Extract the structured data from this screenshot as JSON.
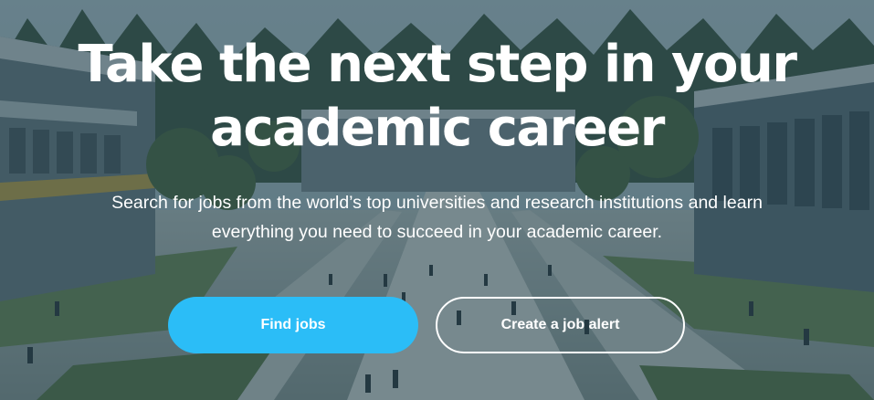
{
  "hero": {
    "title_line1": "Take the next step in your",
    "title_line2": "academic career",
    "subtitle_line1": "Search for jobs from the world’s top universities and research institutions and learn",
    "subtitle_line2": "everything you need to succeed in your academic career.",
    "background": "campus-plaza-photo"
  },
  "actions": {
    "find_jobs_label": "Find jobs",
    "create_alert_label": "Create a job alert"
  },
  "colors": {
    "primary_button": "#2bbdf7",
    "overlay": "#1c3a46",
    "text": "#ffffff"
  }
}
